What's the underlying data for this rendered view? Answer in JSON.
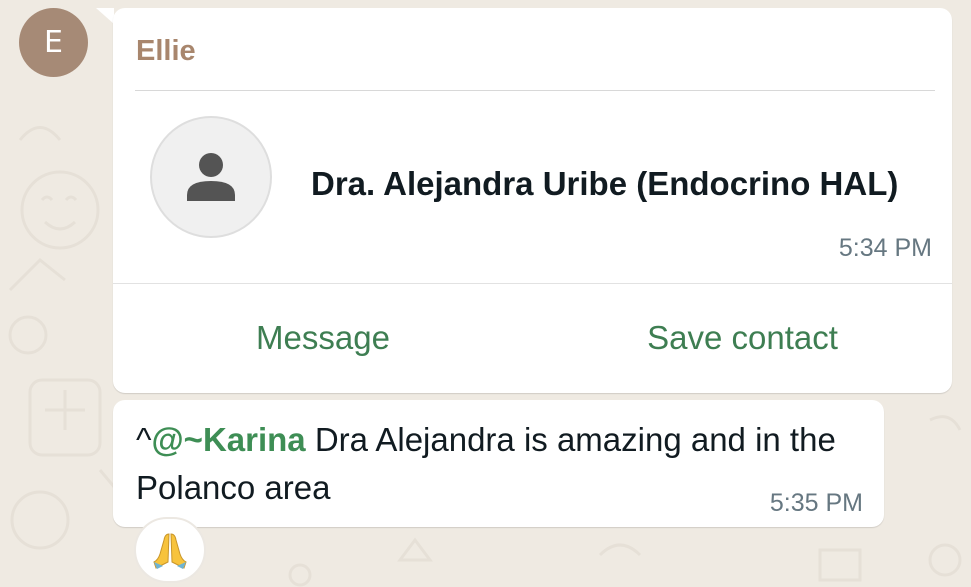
{
  "sender": {
    "initial": "E",
    "name": "Ellie",
    "avatar_color": "#a68a76"
  },
  "contact_card": {
    "contact_name": "Dra. Alejandra Uribe (Endocrino HAL)",
    "photo_icon": "person-icon",
    "time": "5:34 PM",
    "actions": {
      "message_label": "Message",
      "save_label": "Save contact"
    }
  },
  "text_message": {
    "prefix": "^",
    "mention": "@~Karina",
    "body": " Dra Alejandra is amazing and in the Polanco area",
    "time": "5:35 PM",
    "reaction": "🙏"
  },
  "colors": {
    "accent_green": "#3e7e52",
    "sender_name": "#a8866d",
    "background": "#efeae2"
  }
}
